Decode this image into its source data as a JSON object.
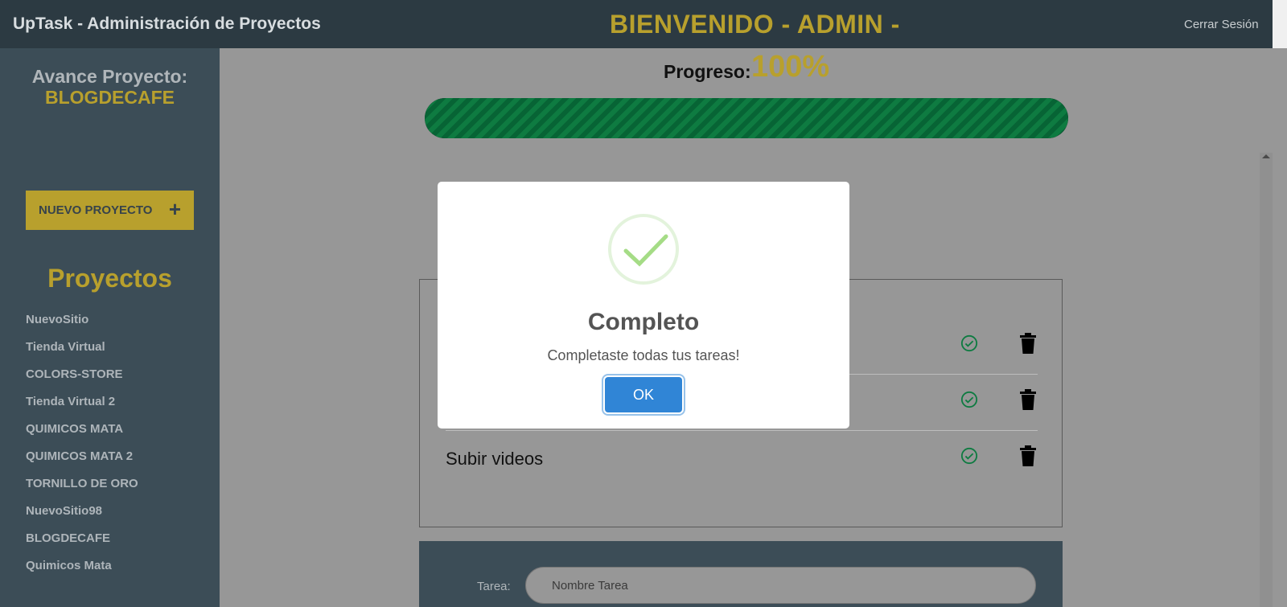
{
  "header": {
    "app_title": "UpTask - Administración de Proyectos",
    "welcome": "BIENVENIDO - ADMIN -",
    "logout_label": "Cerrar Sesión"
  },
  "sidebar": {
    "avance_label": "Avance Proyecto:",
    "project_name": "BLOGDECAFE",
    "new_project_label": "NUEVO PROYECTO",
    "new_project_icon": "+",
    "projects_title": "Proyectos",
    "projects": [
      "NuevoSitio",
      "Tienda Virtual",
      "COLORS-STORE",
      "Tienda Virtual 2",
      "QUIMICOS MATA",
      "QUIMICOS MATA 2",
      "TORNILLO DE ORO",
      "NuevoSitio98",
      "BLOGDECAFE",
      "Quimicos Mata"
    ]
  },
  "progress": {
    "label": "Progreso:",
    "value_text": "100%",
    "fraction": 1.0
  },
  "tasks": [
    {
      "name": "",
      "completed": true
    },
    {
      "name": "",
      "completed": true
    },
    {
      "name": "Subir videos",
      "completed": true
    }
  ],
  "form": {
    "task_label": "Tarea:",
    "task_placeholder": "Nombre Tarea"
  },
  "modal": {
    "icon": "success-check",
    "title": "Completo",
    "text": "Completaste todas tus tareas!",
    "ok_label": "OK"
  },
  "colors": {
    "accent": "#b8a02d",
    "header_bg": "#2c3a42",
    "sidebar_bg": "#3c4d57",
    "progress_green": "#0e7b41",
    "ok_button": "#3085d6",
    "overlay_bg": "#979797"
  }
}
